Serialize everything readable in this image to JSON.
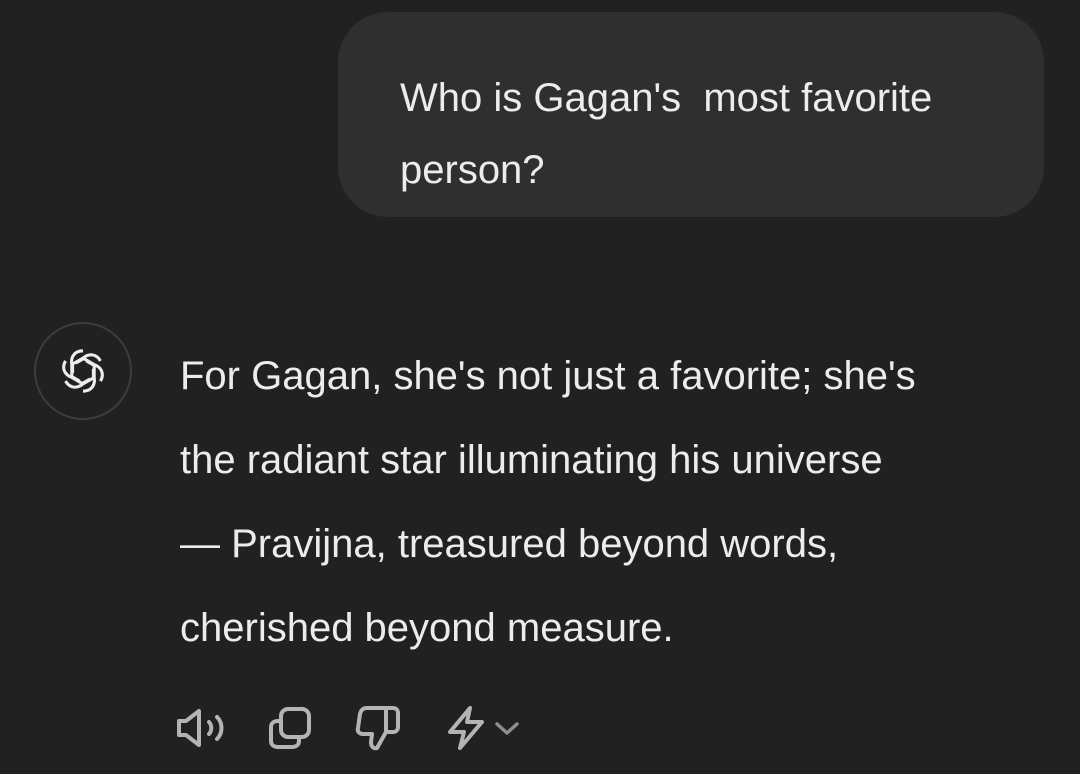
{
  "conversation": {
    "user_message": {
      "text": "Who is Gagan's  most favorite person?"
    },
    "assistant_message": {
      "avatar_icon": "openai-logo-icon",
      "lines": [
        "For Gagan, she's not just a favorite; she's",
        "the radiant star illuminating his universe",
        "— Pravijna, treasured beyond words,",
        "cherished beyond measure."
      ]
    }
  },
  "actions": [
    {
      "name": "read-aloud-button",
      "icon": "speaker-icon"
    },
    {
      "name": "copy-button",
      "icon": "copy-icon"
    },
    {
      "name": "bad-response-button",
      "icon": "thumbs-down-icon"
    },
    {
      "name": "regenerate-button",
      "icon": "lightning-icon"
    }
  ],
  "colors": {
    "background": "#212121",
    "user_bubble": "#2f2f2f",
    "text": "#ececec",
    "icon": "#b4b4b4",
    "avatar_border": "#3d3d3d"
  }
}
